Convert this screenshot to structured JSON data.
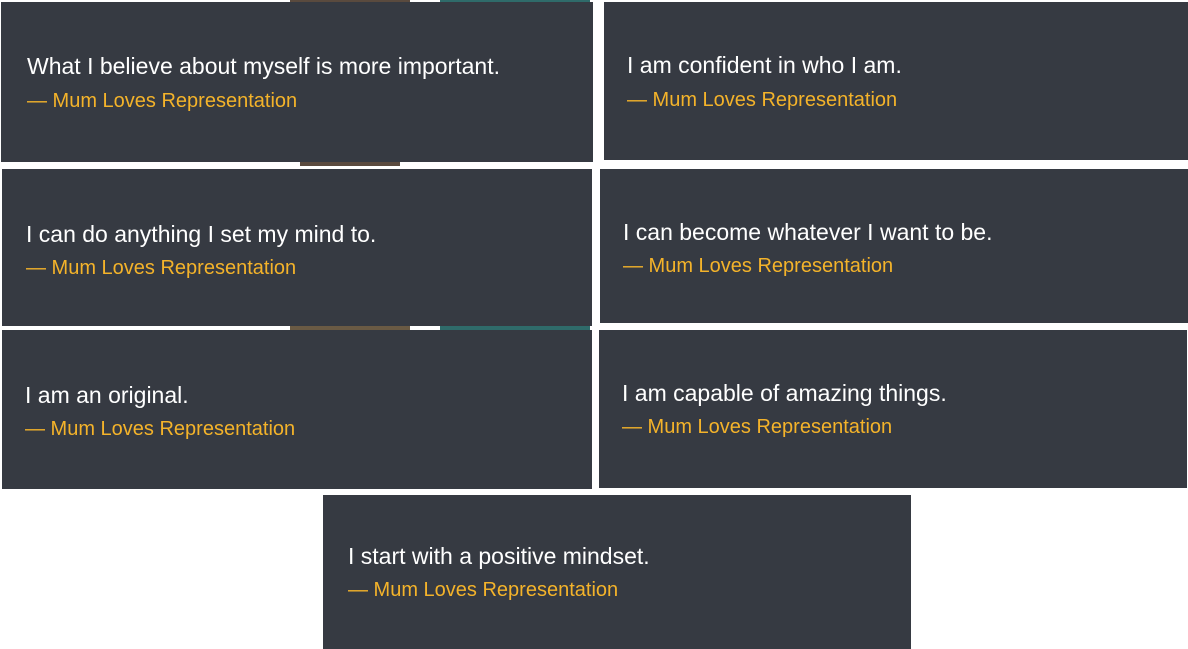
{
  "quotes": [
    {
      "text": "What I believe about myself is more important.",
      "author": "— Mum Loves Representation"
    },
    {
      "text": "I am confident in who I am.",
      "author": "— Mum Loves Representation"
    },
    {
      "text": "I can do anything I set my mind to.",
      "author": "— Mum Loves Representation"
    },
    {
      "text": "I can become whatever I want to be.",
      "author": "— Mum Loves Representation"
    },
    {
      "text": "I am an original.",
      "author": "— Mum Loves Representation"
    },
    {
      "text": "I am capable of amazing things.",
      "author": "— Mum Loves Representation"
    },
    {
      "text": "I start with a positive mindset.",
      "author": "— Mum Loves Representation"
    }
  ],
  "colors": {
    "card_background": "#363a42",
    "quote_text": "#ffffff",
    "author_text": "#f4b32a",
    "page_background": "#ffffff"
  }
}
